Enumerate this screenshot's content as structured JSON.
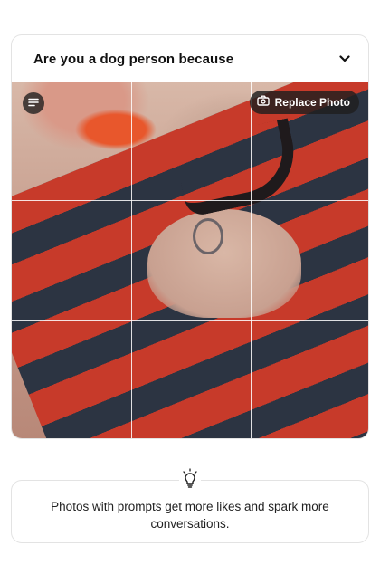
{
  "prompt_card": {
    "title": "Are you a dog person because",
    "chevron_icon": "chevron-down-icon"
  },
  "photo": {
    "menu_icon": "list-icon",
    "replace_button_label": "Replace Photo",
    "replace_icon": "camera-icon",
    "grid": {
      "rows": 3,
      "columns": 3
    }
  },
  "tip": {
    "icon": "lightbulb-icon",
    "text": "Photos with prompts get more likes and spark more conversations."
  }
}
